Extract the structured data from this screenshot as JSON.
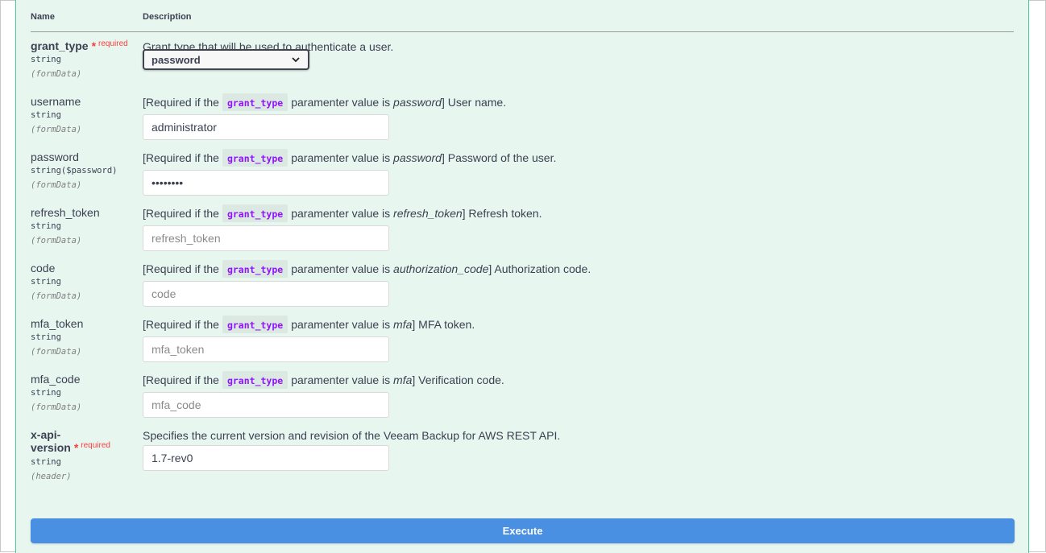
{
  "table": {
    "col_name": "Name",
    "col_description": "Description"
  },
  "required_label": "required",
  "required_star": "*",
  "params": [
    {
      "name": "grant_type",
      "type": "string",
      "in": "(formData)",
      "description": "Grant type that will be used to authenticate a user.",
      "selected": "password"
    },
    {
      "name": "username",
      "type": "string",
      "in": "(formData)",
      "desc_prefix": "[Required if the",
      "desc_code": "grant_type",
      "desc_mid": "paramenter value is",
      "desc_em": "password",
      "desc_suffix": "] User name.",
      "value": "administrator"
    },
    {
      "name": "password",
      "type": "string($password)",
      "in": "(formData)",
      "desc_prefix": "[Required if the",
      "desc_code": "grant_type",
      "desc_mid": "paramenter value is",
      "desc_em": "password",
      "desc_suffix": "] Password of the user.",
      "value": "••••••••"
    },
    {
      "name": "refresh_token",
      "type": "string",
      "in": "(formData)",
      "desc_prefix": "[Required if the",
      "desc_code": "grant_type",
      "desc_mid": "paramenter value is",
      "desc_em": "refresh_token",
      "desc_suffix": "] Refresh token.",
      "placeholder": "refresh_token"
    },
    {
      "name": "code",
      "type": "string",
      "in": "(formData)",
      "desc_prefix": "[Required if the",
      "desc_code": "grant_type",
      "desc_mid": "paramenter value is",
      "desc_em": "authorization_code",
      "desc_suffix": "] Authorization code.",
      "placeholder": "code"
    },
    {
      "name": "mfa_token",
      "type": "string",
      "in": "(formData)",
      "desc_prefix": "[Required if the",
      "desc_code": "grant_type",
      "desc_mid": "paramenter value is",
      "desc_em": "mfa",
      "desc_suffix": "] MFA token.",
      "placeholder": "mfa_token"
    },
    {
      "name": "mfa_code",
      "type": "string",
      "in": "(formData)",
      "desc_prefix": "[Required if the",
      "desc_code": "grant_type",
      "desc_mid": "paramenter value is",
      "desc_em": "mfa",
      "desc_suffix": "] Verification code.",
      "placeholder": "mfa_code"
    },
    {
      "name_line1": "x-api-",
      "name_line2": "version",
      "type": "string",
      "in": "(header)",
      "description": "Specifies the current version and revision of the Veeam Backup for AWS REST API.",
      "value": "1.7-rev0"
    }
  ],
  "execute_label": "Execute",
  "colors": {
    "panel_bg": "#e8f6f0",
    "panel_border": "#49cc90",
    "code_purple": "#9012fe",
    "required_red": "#f93e3e",
    "execute_blue": "#4990e2"
  }
}
